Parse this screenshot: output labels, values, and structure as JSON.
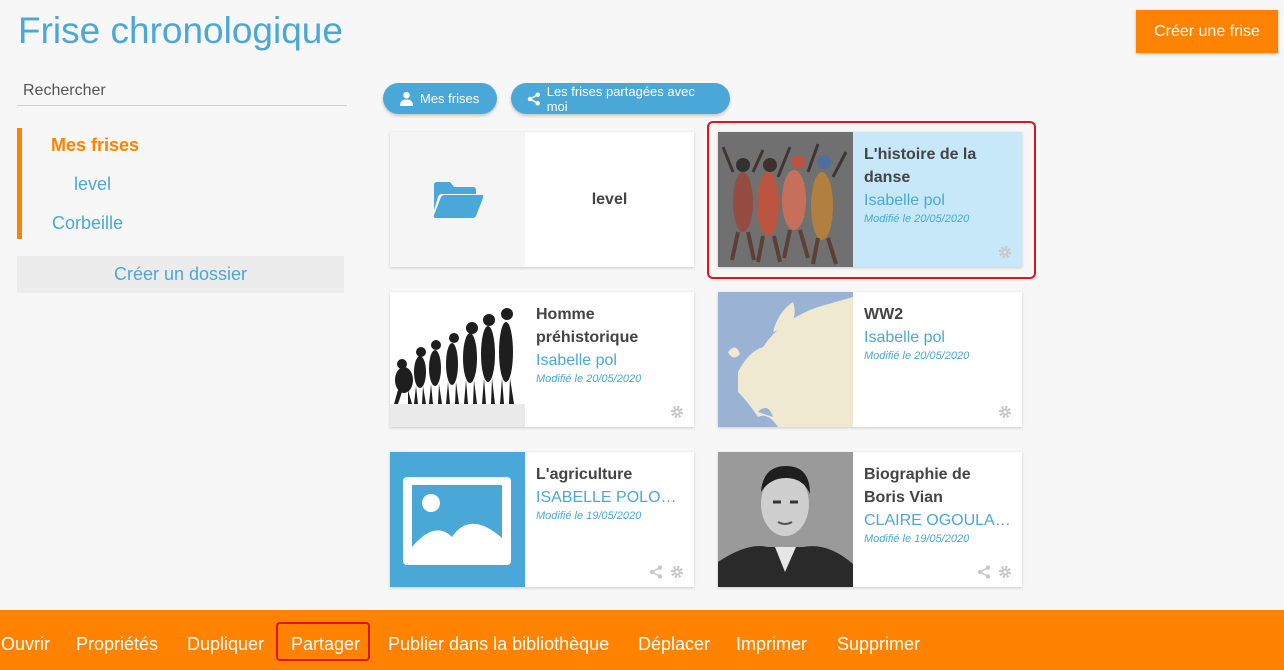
{
  "header": {
    "title": "Frise chronologique",
    "create_button": "Créer une frise"
  },
  "sidebar": {
    "search_placeholder": "Rechercher",
    "items": [
      {
        "label": "Mes frises",
        "active": true
      },
      {
        "label": "level",
        "active": false
      },
      {
        "label": "Corbeille",
        "active": false
      }
    ],
    "create_folder": "Créer un dossier"
  },
  "tabs": [
    {
      "label": "Mes frises",
      "icon": "user-icon"
    },
    {
      "label": "Les frises partagées avec moi",
      "icon": "share-icon"
    }
  ],
  "cards": [
    {
      "type": "folder",
      "title": "level",
      "icon": "folder-open-icon"
    },
    {
      "title": "L'histoire de la danse",
      "author": "Isabelle pol",
      "date": "Modifié le 20/05/2020",
      "selected": true
    },
    {
      "title": "Homme préhistorique",
      "author": "Isabelle pol",
      "date": "Modifié le 20/05/2020"
    },
    {
      "title": "WW2",
      "author": "Isabelle pol",
      "date": "Modifié le 20/05/2020"
    },
    {
      "title": "L'agriculture",
      "author": "ISABELLE POLONI…",
      "date": "Modifié le 19/05/2020",
      "shared": true
    },
    {
      "title": "Biographie de Boris Vian",
      "author": "CLAIRE OGOULA-N…",
      "date": "Modifié le 19/05/2020",
      "shared": true
    }
  ],
  "toolbar": {
    "items": [
      "Ouvrir",
      "Propriétés",
      "Dupliquer",
      "Partager",
      "Publier dans la bibliothèque",
      "Déplacer",
      "Imprimer",
      "Supprimer"
    ]
  },
  "colors": {
    "accent": "#ff8300",
    "primary": "#4aa8d8",
    "selection": "#e0141e",
    "selected_card_bg": "#c6e8f9"
  }
}
